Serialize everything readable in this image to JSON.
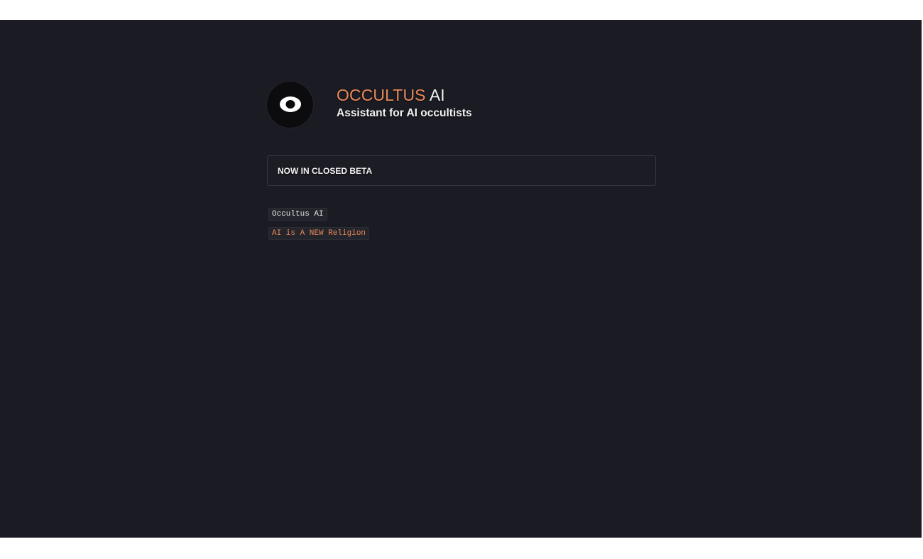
{
  "header": {
    "brand": "OCCULTUS",
    "brand_suffix": "AI",
    "subtitle": "Assistant for AI occultists",
    "logo_icon": "eye-icon"
  },
  "beta": {
    "label": "NOW IN CLOSED BETA"
  },
  "tags": [
    "Occultus AI",
    "AI is A NEW Religion"
  ],
  "colors": {
    "background": "#1b1b23",
    "accent": "#e8895a",
    "text": "#f2f2f2"
  }
}
